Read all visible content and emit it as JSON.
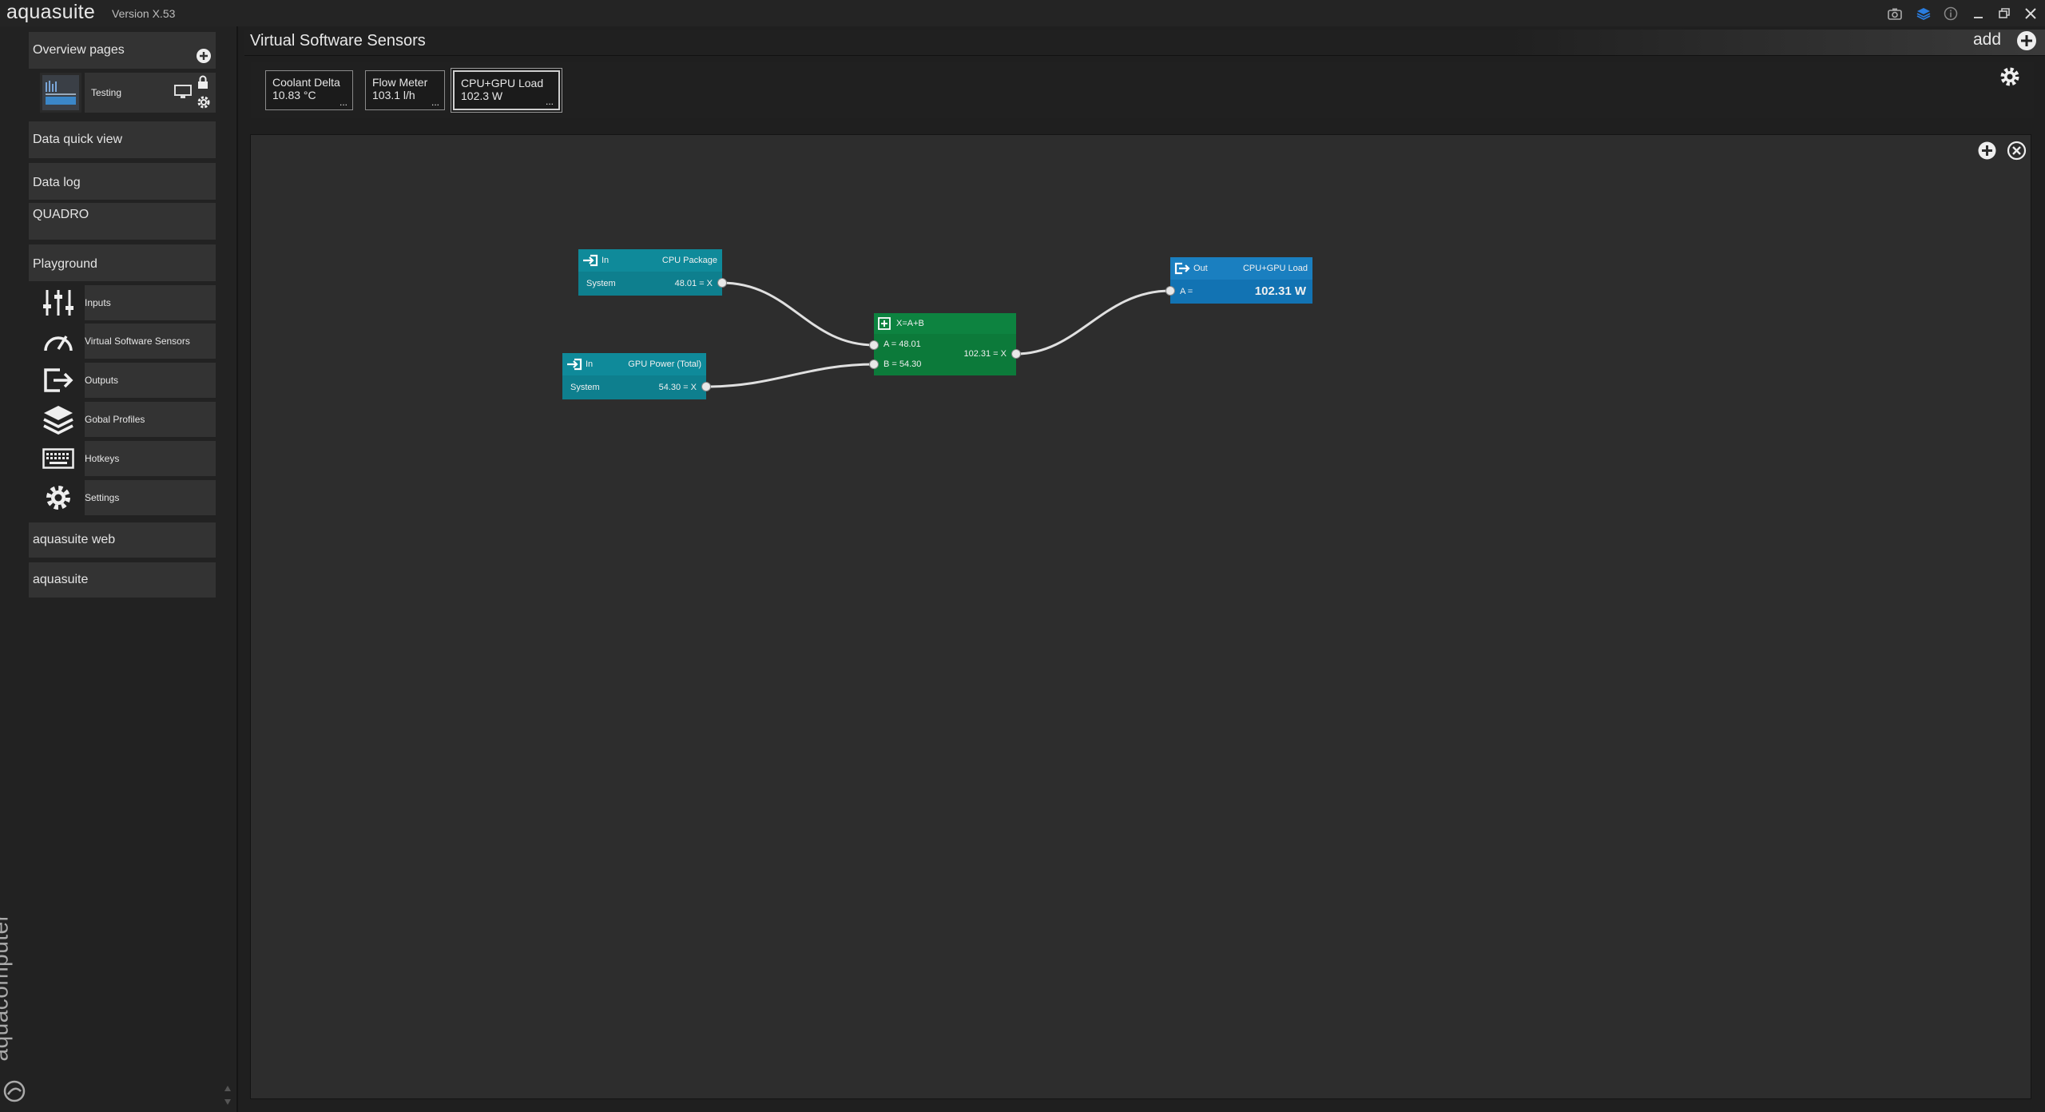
{
  "app": {
    "name": "aquasuite",
    "version": "Version X.53"
  },
  "sidebar": {
    "overview_pages": "Overview pages",
    "testing_item": "Testing",
    "data_quick_view": "Data quick view",
    "data_log": "Data log",
    "quadro": "QUADRO",
    "playground": "Playground",
    "items": [
      {
        "label": "Inputs",
        "icon": "sliders-icon"
      },
      {
        "label": "Virtual Software Sensors",
        "icon": "gauge-icon"
      },
      {
        "label": "Outputs",
        "icon": "output-icon"
      },
      {
        "label": "Gobal Profiles",
        "icon": "layers-icon"
      },
      {
        "label": "Hotkeys",
        "icon": "keyboard-icon"
      },
      {
        "label": "Settings",
        "icon": "gear-icon"
      }
    ],
    "aquasuite_web": "aquasuite web",
    "aquasuite": "aquasuite",
    "brand": "aquacomputer"
  },
  "main": {
    "title": "Virtual Software Sensors",
    "add_label": "add",
    "tiles": [
      {
        "name": "Coolant Delta",
        "value": "10.83 °C",
        "dots": "..."
      },
      {
        "name": "Flow Meter",
        "value": "103.1 l/h",
        "dots": "..."
      },
      {
        "name": "CPU+GPU Load",
        "value": "102.3 W",
        "dots": "..."
      }
    ]
  },
  "nodes": {
    "in1": {
      "type": "In",
      "title": "CPU Package",
      "source": "System",
      "value": "48.01 = X"
    },
    "in2": {
      "type": "In",
      "title": "GPU Power (Total)",
      "source": "System",
      "value": "54.30 = X"
    },
    "op": {
      "title": "X=A+B",
      "a": "A = 48.01",
      "b": "B = 54.30",
      "result": "102.31 = X"
    },
    "out": {
      "type": "Out",
      "title": "CPU+GPU Load",
      "a_label": "A =",
      "value": "102.31 W"
    }
  },
  "colors": {
    "in_node": "#0e8a99",
    "op_node": "#0d7b3b",
    "out_node": "#1477b8",
    "canvas": "#2d2d2d"
  }
}
